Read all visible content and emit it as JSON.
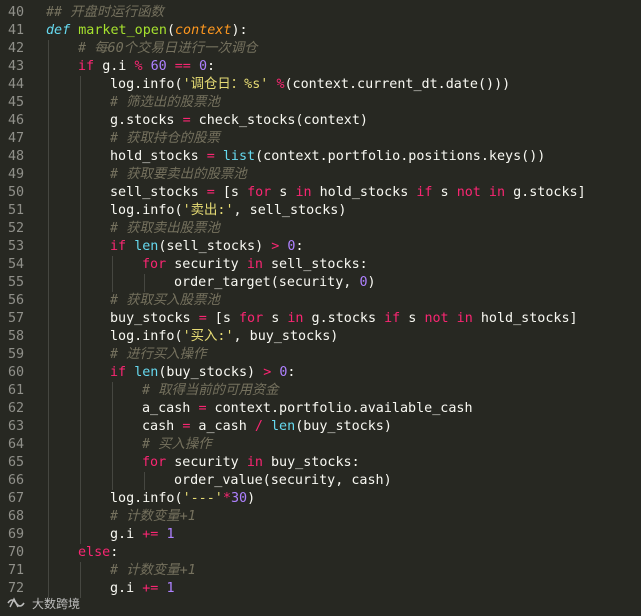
{
  "editor": {
    "lines": [
      {
        "n": "40",
        "indent": 0,
        "tokens": [
          [
            "cm",
            "## 开盘时运行函数"
          ]
        ]
      },
      {
        "n": "41",
        "indent": 0,
        "tokens": [
          [
            "def",
            "def "
          ],
          [
            "fn",
            "market_open"
          ],
          [
            "plain",
            "("
          ],
          [
            "param",
            "context"
          ],
          [
            "plain",
            "):"
          ]
        ]
      },
      {
        "n": "42",
        "indent": 1,
        "tokens": [
          [
            "cm",
            "# 每60个交易日进行一次调仓"
          ]
        ]
      },
      {
        "n": "43",
        "indent": 1,
        "tokens": [
          [
            "kw",
            "if "
          ],
          [
            "plain",
            "g.i "
          ],
          [
            "op",
            "%"
          ],
          [
            "plain",
            " "
          ],
          [
            "num",
            "60"
          ],
          [
            "plain",
            " "
          ],
          [
            "op",
            "=="
          ],
          [
            "plain",
            " "
          ],
          [
            "num",
            "0"
          ],
          [
            "plain",
            ":"
          ]
        ]
      },
      {
        "n": "44",
        "indent": 2,
        "tokens": [
          [
            "plain",
            "log.info("
          ],
          [
            "str",
            "'调仓日：%s'"
          ],
          [
            "plain",
            " "
          ],
          [
            "op",
            "%"
          ],
          [
            "plain",
            "(context.current_dt.date()))"
          ]
        ]
      },
      {
        "n": "45",
        "indent": 2,
        "tokens": [
          [
            "cm",
            "# 筛选出的股票池"
          ]
        ]
      },
      {
        "n": "46",
        "indent": 2,
        "tokens": [
          [
            "plain",
            "g.stocks "
          ],
          [
            "op",
            "="
          ],
          [
            "plain",
            " check_stocks(context)"
          ]
        ]
      },
      {
        "n": "47",
        "indent": 2,
        "tokens": [
          [
            "cm",
            "# 获取持仓的股票"
          ]
        ]
      },
      {
        "n": "48",
        "indent": 2,
        "tokens": [
          [
            "plain",
            "hold_stocks "
          ],
          [
            "op",
            "="
          ],
          [
            "plain",
            " "
          ],
          [
            "bi",
            "list"
          ],
          [
            "plain",
            "(context.portfolio.positions.keys())"
          ]
        ]
      },
      {
        "n": "49",
        "indent": 2,
        "tokens": [
          [
            "cm",
            "# 获取要卖出的股票池"
          ]
        ]
      },
      {
        "n": "50",
        "indent": 2,
        "tokens": [
          [
            "plain",
            "sell_stocks "
          ],
          [
            "op",
            "="
          ],
          [
            "plain",
            " [s "
          ],
          [
            "kw",
            "for"
          ],
          [
            "plain",
            " s "
          ],
          [
            "kw",
            "in"
          ],
          [
            "plain",
            " hold_stocks "
          ],
          [
            "kw",
            "if"
          ],
          [
            "plain",
            " s "
          ],
          [
            "kw",
            "not in"
          ],
          [
            "plain",
            " g.stocks]"
          ]
        ]
      },
      {
        "n": "51",
        "indent": 2,
        "tokens": [
          [
            "plain",
            "log.info("
          ],
          [
            "str",
            "'卖出:'"
          ],
          [
            "plain",
            ", sell_stocks)"
          ]
        ]
      },
      {
        "n": "52",
        "indent": 2,
        "tokens": [
          [
            "cm",
            "# 获取卖出股票池"
          ]
        ]
      },
      {
        "n": "53",
        "indent": 2,
        "tokens": [
          [
            "kw",
            "if "
          ],
          [
            "bi",
            "len"
          ],
          [
            "plain",
            "(sell_stocks) "
          ],
          [
            "op",
            ">"
          ],
          [
            "plain",
            " "
          ],
          [
            "num",
            "0"
          ],
          [
            "plain",
            ":"
          ]
        ]
      },
      {
        "n": "54",
        "indent": 3,
        "tokens": [
          [
            "kw",
            "for"
          ],
          [
            "plain",
            " security "
          ],
          [
            "kw",
            "in"
          ],
          [
            "plain",
            " sell_stocks:"
          ]
        ]
      },
      {
        "n": "55",
        "indent": 4,
        "tokens": [
          [
            "plain",
            "order_target(security, "
          ],
          [
            "num",
            "0"
          ],
          [
            "plain",
            ")"
          ]
        ]
      },
      {
        "n": "56",
        "indent": 2,
        "tokens": [
          [
            "cm",
            "# 获取买入股票池"
          ]
        ]
      },
      {
        "n": "57",
        "indent": 2,
        "tokens": [
          [
            "plain",
            "buy_stocks "
          ],
          [
            "op",
            "="
          ],
          [
            "plain",
            " [s "
          ],
          [
            "kw",
            "for"
          ],
          [
            "plain",
            " s "
          ],
          [
            "kw",
            "in"
          ],
          [
            "plain",
            " g.stocks "
          ],
          [
            "kw",
            "if"
          ],
          [
            "plain",
            " s "
          ],
          [
            "kw",
            "not in"
          ],
          [
            "plain",
            " hold_stocks]"
          ]
        ]
      },
      {
        "n": "58",
        "indent": 2,
        "tokens": [
          [
            "plain",
            "log.info("
          ],
          [
            "str",
            "'买入:'"
          ],
          [
            "plain",
            ", buy_stocks)"
          ]
        ]
      },
      {
        "n": "59",
        "indent": 2,
        "tokens": [
          [
            "cm",
            "# 进行买入操作"
          ]
        ]
      },
      {
        "n": "60",
        "indent": 2,
        "tokens": [
          [
            "kw",
            "if "
          ],
          [
            "bi",
            "len"
          ],
          [
            "plain",
            "(buy_stocks) "
          ],
          [
            "op",
            ">"
          ],
          [
            "plain",
            " "
          ],
          [
            "num",
            "0"
          ],
          [
            "plain",
            ":"
          ]
        ]
      },
      {
        "n": "61",
        "indent": 3,
        "tokens": [
          [
            "cm",
            "# 取得当前的可用资金"
          ]
        ]
      },
      {
        "n": "62",
        "indent": 3,
        "tokens": [
          [
            "plain",
            "a_cash "
          ],
          [
            "op",
            "="
          ],
          [
            "plain",
            " context.portfolio.available_cash"
          ]
        ]
      },
      {
        "n": "63",
        "indent": 3,
        "tokens": [
          [
            "plain",
            "cash "
          ],
          [
            "op",
            "="
          ],
          [
            "plain",
            " a_cash "
          ],
          [
            "op",
            "/"
          ],
          [
            "plain",
            " "
          ],
          [
            "bi",
            "len"
          ],
          [
            "plain",
            "(buy_stocks)"
          ]
        ]
      },
      {
        "n": "64",
        "indent": 3,
        "tokens": [
          [
            "cm",
            "# 买入操作"
          ]
        ]
      },
      {
        "n": "65",
        "indent": 3,
        "tokens": [
          [
            "kw",
            "for"
          ],
          [
            "plain",
            " security "
          ],
          [
            "kw",
            "in"
          ],
          [
            "plain",
            " buy_stocks:"
          ]
        ]
      },
      {
        "n": "66",
        "indent": 4,
        "tokens": [
          [
            "plain",
            "order_value(security, cash)"
          ]
        ]
      },
      {
        "n": "67",
        "indent": 2,
        "tokens": [
          [
            "plain",
            "log.info("
          ],
          [
            "str",
            "'---'"
          ],
          [
            "op",
            "*"
          ],
          [
            "num",
            "30"
          ],
          [
            "plain",
            ")"
          ]
        ]
      },
      {
        "n": "68",
        "indent": 2,
        "tokens": [
          [
            "cm",
            "# 计数变量+1"
          ]
        ]
      },
      {
        "n": "69",
        "indent": 2,
        "tokens": [
          [
            "plain",
            "g.i "
          ],
          [
            "op",
            "+="
          ],
          [
            "plain",
            " "
          ],
          [
            "num",
            "1"
          ]
        ]
      },
      {
        "n": "70",
        "indent": 1,
        "tokens": [
          [
            "kw",
            "else"
          ],
          [
            "plain",
            ":"
          ]
        ]
      },
      {
        "n": "71",
        "indent": 2,
        "tokens": [
          [
            "cm",
            "# 计数变量+1"
          ]
        ]
      },
      {
        "n": "72",
        "indent": 2,
        "tokens": [
          [
            "plain",
            "g.i "
          ],
          [
            "op",
            "+="
          ],
          [
            "plain",
            " "
          ],
          [
            "num",
            "1"
          ]
        ]
      }
    ]
  },
  "watermark": {
    "text": "大数跨境"
  },
  "colors": {
    "background": "#272822",
    "keyword": "#f92672",
    "function": "#a6e22e",
    "string": "#e6db74",
    "number": "#ae81ff",
    "comment": "#75715e",
    "builtin": "#66d9ef",
    "param": "#fd971f",
    "line_number": "#90908a"
  }
}
